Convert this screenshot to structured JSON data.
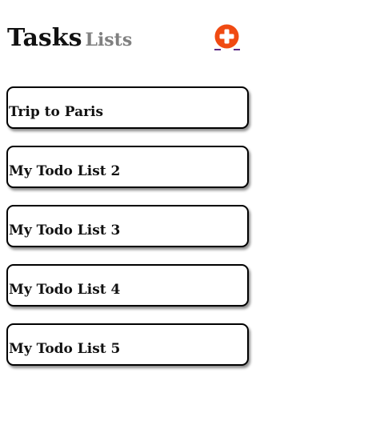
{
  "header": {
    "title": "Tasks",
    "subtitle": "Lists",
    "add_icon": "plus-circle-icon",
    "add_color": "#f04a12"
  },
  "lists": [
    {
      "label": "Trip to Paris"
    },
    {
      "label": "My Todo List 2"
    },
    {
      "label": "My Todo List 3"
    },
    {
      "label": "My Todo List 4"
    },
    {
      "label": "My Todo List 5"
    }
  ]
}
